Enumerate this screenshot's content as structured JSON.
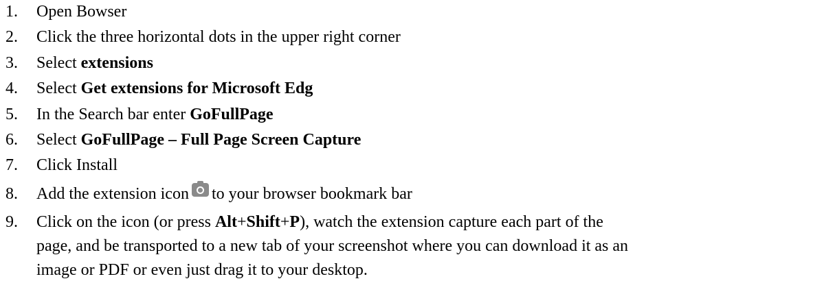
{
  "steps": [
    {
      "num": "1.",
      "text": "Open Bowser"
    },
    {
      "num": "2.",
      "text": "Click the three horizontal dots in the upper right corner"
    },
    {
      "num": "3.",
      "pre": "Select ",
      "bold": "extensions"
    },
    {
      "num": "4.",
      "pre": "Select ",
      "bold": "Get extensions for Microsoft Edg"
    },
    {
      "num": "5.",
      "pre": "In the Search bar enter ",
      "bold": "GoFullPage"
    },
    {
      "num": "6.",
      "pre": "Select ",
      "bold": "GoFullPage – Full Page Screen Capture"
    },
    {
      "num": "7.",
      "text": "Click Install"
    },
    {
      "num": "8.",
      "pre": "Add the extension icon",
      "icon": "camera-icon",
      "post": "to your browser bookmark bar"
    },
    {
      "num": "9.",
      "pre": "Click on the icon (or press ",
      "key1": "Alt",
      "plus1": "+",
      "key2": "Shift",
      "plus2": "+",
      "key3": "P",
      "post": "), watch the extension capture each part of the",
      "line2": "page, and be transported to a new tab of your screenshot where you can download it as an",
      "line3": "image or PDF or even just drag it to your desktop."
    }
  ],
  "colors": {
    "text": "#000000",
    "icon": "#8a8a8a"
  }
}
